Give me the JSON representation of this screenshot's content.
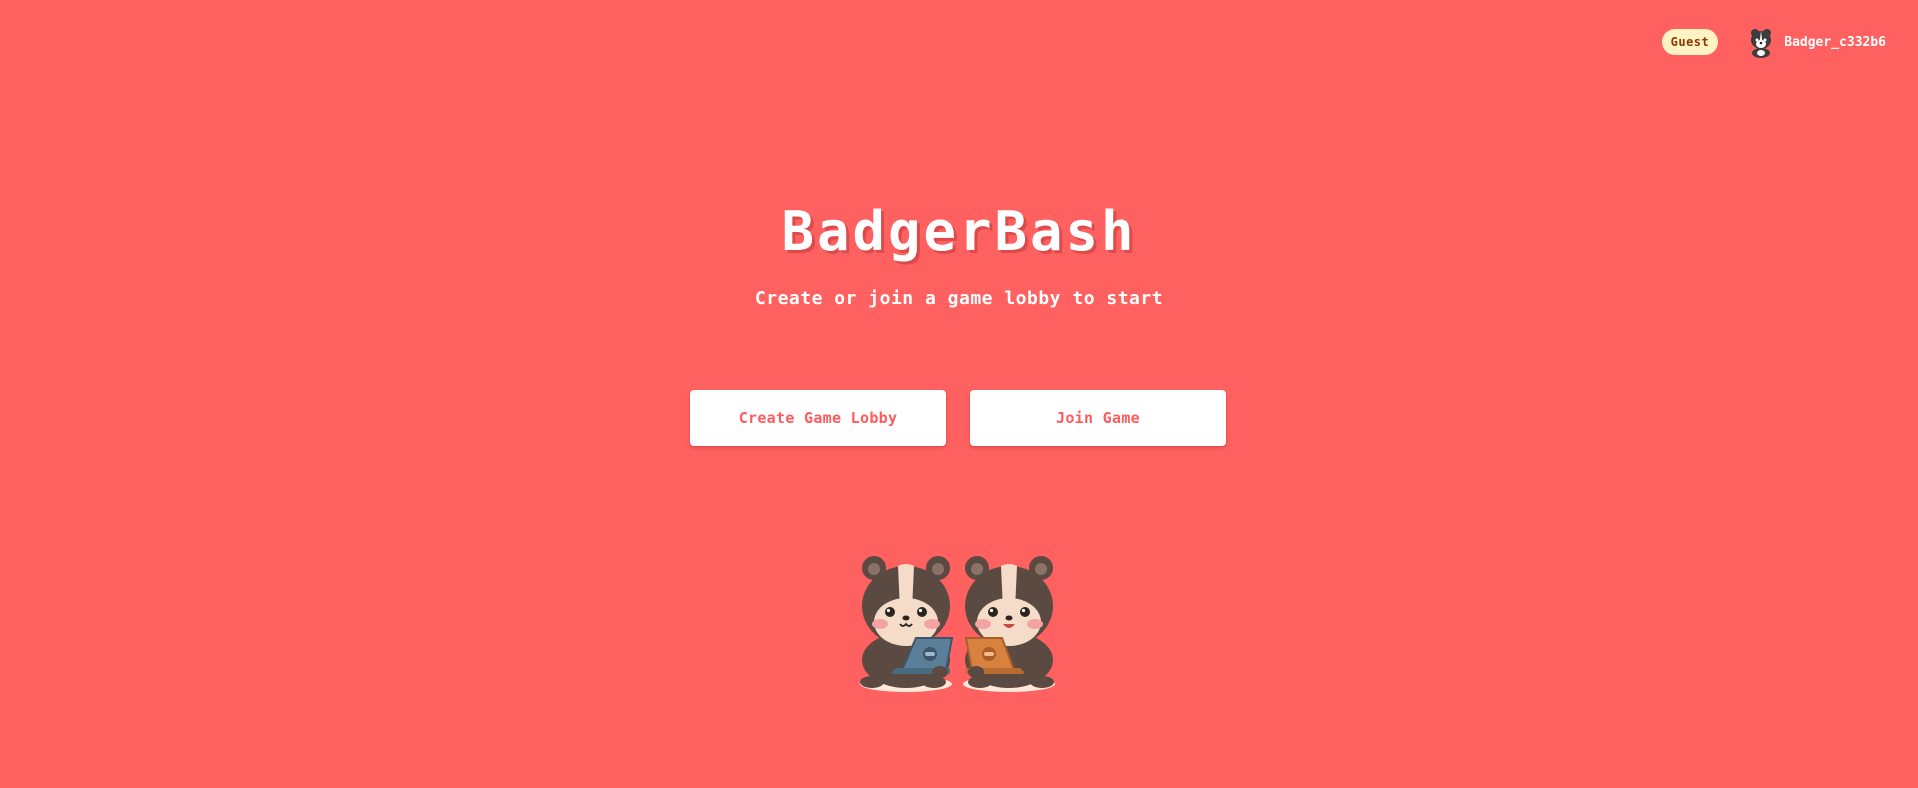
{
  "header": {
    "guest_badge": "Guest",
    "username": "Badger_c332b6",
    "avatar_icon": "badger-avatar-icon"
  },
  "hero": {
    "title": "BadgerBash",
    "subtitle": "Create or join a game lobby to start"
  },
  "actions": {
    "create_label": "Create Game Lobby",
    "join_label": "Join Game"
  },
  "illustration": {
    "icon": "badgers-with-laptops-illustration"
  },
  "colors": {
    "background": "#ff6161",
    "button_text": "#ff5b5b",
    "badge_bg": "#fff3c4",
    "badger_fur": "#5a4a42",
    "badger_face": "#f5dcc8",
    "laptop_blue": "#5b7f99",
    "laptop_orange": "#d9823f"
  }
}
